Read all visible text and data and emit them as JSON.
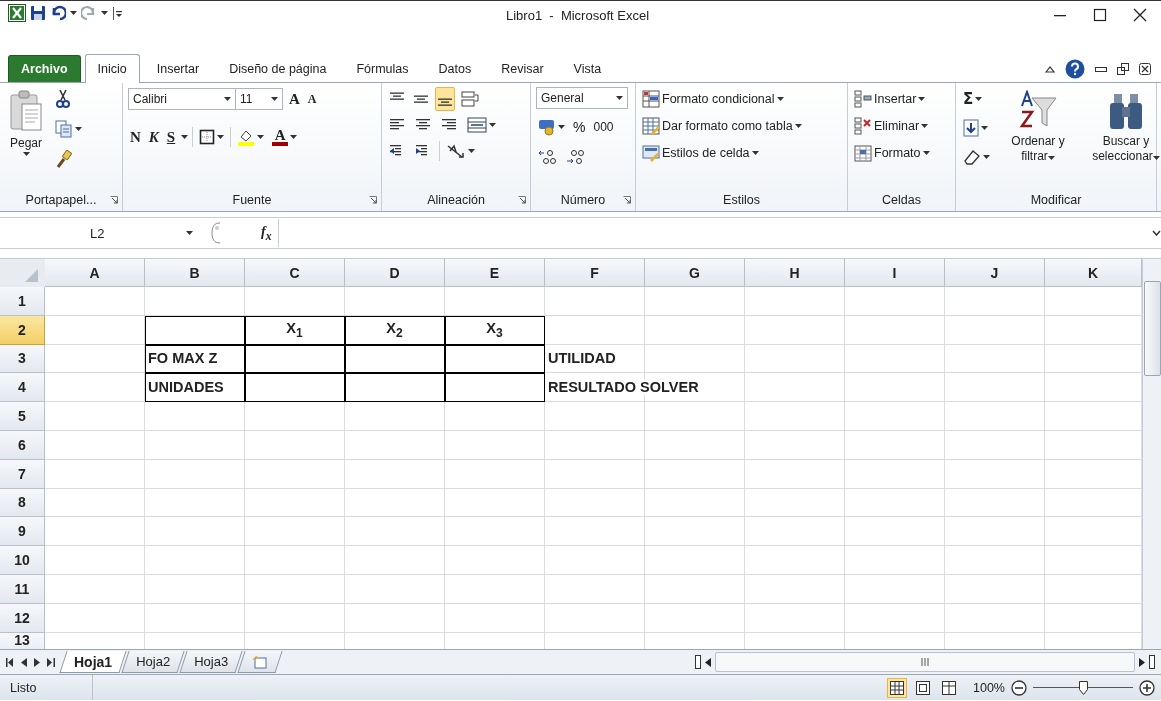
{
  "window": {
    "title": "Libro1  -  Microsoft Excel"
  },
  "ribbon_tabs": [
    {
      "label": "Archivo",
      "kind": "file",
      "selected": false
    },
    {
      "label": "Inicio",
      "kind": "tab",
      "selected": true
    },
    {
      "label": "Insertar",
      "kind": "tab",
      "selected": false
    },
    {
      "label": "Diseño de página",
      "kind": "tab",
      "selected": false
    },
    {
      "label": "Fórmulas",
      "kind": "tab",
      "selected": false
    },
    {
      "label": "Datos",
      "kind": "tab",
      "selected": false
    },
    {
      "label": "Revisar",
      "kind": "tab",
      "selected": false
    },
    {
      "label": "Vista",
      "kind": "tab",
      "selected": false
    }
  ],
  "clipboard": {
    "paste": "Pegar",
    "label": "Portapapel..."
  },
  "font": {
    "name": "Calibri",
    "size": "11",
    "grow": "A",
    "shrink": "A",
    "bold": "N",
    "italic": "K",
    "underline": "S",
    "font_color": "A",
    "label": "Fuente"
  },
  "alignment": {
    "vertical": [
      {
        "selected": false
      },
      {
        "selected": false
      },
      {
        "selected": true
      }
    ],
    "label": "Alineación"
  },
  "number": {
    "format": "General",
    "percent": "%",
    "thousands": "000",
    "label": "Número"
  },
  "styles": {
    "items": [
      "Formato condicional",
      "Dar formato como tabla",
      "Estilos de celda"
    ],
    "label": "Estilos"
  },
  "cells": {
    "items": [
      "Insertar",
      "Eliminar",
      "Formato"
    ],
    "label": "Celdas"
  },
  "editing": {
    "autosum": "Σ",
    "sort": "Ordenar y filtrar",
    "find": "Buscar y seleccionar",
    "label": "Modificar"
  },
  "formula_bar": {
    "name_box": "L2",
    "function_label": "f$_{x}$"
  },
  "sheet": {
    "columns": [
      "A",
      "B",
      "C",
      "D",
      "E",
      "F",
      "G",
      "H",
      "I",
      "J",
      "K"
    ],
    "rows": [
      {
        "header": "1",
        "selected": false,
        "cells": [
          null,
          null,
          null,
          null,
          null,
          null,
          null,
          null,
          null,
          null,
          null
        ]
      },
      {
        "header": "2",
        "selected": true,
        "cells": [
          null,
          {
            "border": true
          },
          {
            "text": "X$_{1}$",
            "bold": true,
            "centered": true,
            "border": true
          },
          {
            "text": "X$_{2}$",
            "bold": true,
            "centered": true,
            "border": true
          },
          {
            "text": "X$_{3}$",
            "bold": true,
            "centered": true,
            "border": true
          },
          null,
          null,
          null,
          null,
          null,
          null
        ]
      },
      {
        "header": "3",
        "selected": false,
        "cells": [
          null,
          {
            "text": "FO MAX Z",
            "bold": true,
            "centered": false,
            "border": true
          },
          {
            "border": true
          },
          {
            "border": true
          },
          {
            "border": true
          },
          {
            "text": "UTILIDAD",
            "bold": true,
            "centered": false,
            "border": false
          },
          null,
          null,
          null,
          null,
          null
        ]
      },
      {
        "header": "4",
        "selected": false,
        "cells": [
          null,
          {
            "text": "UNIDADES",
            "bold": true,
            "centered": false,
            "border": true
          },
          {
            "border": true
          },
          {
            "border": true
          },
          {
            "border": true
          },
          {
            "text": "RESULTADO SOLVER",
            "bold": true,
            "centered": false,
            "border": false
          },
          null,
          null,
          null,
          null,
          null
        ]
      },
      {
        "header": "5",
        "selected": false,
        "cells": [
          null,
          null,
          null,
          null,
          null,
          null,
          null,
          null,
          null,
          null,
          null
        ]
      },
      {
        "header": "6",
        "selected": false,
        "cells": [
          null,
          null,
          null,
          null,
          null,
          null,
          null,
          null,
          null,
          null,
          null
        ]
      },
      {
        "header": "7",
        "selected": false,
        "cells": [
          null,
          null,
          null,
          null,
          null,
          null,
          null,
          null,
          null,
          null,
          null
        ]
      },
      {
        "header": "8",
        "selected": false,
        "cells": [
          null,
          null,
          null,
          null,
          null,
          null,
          null,
          null,
          null,
          null,
          null
        ]
      },
      {
        "header": "9",
        "selected": false,
        "cells": [
          null,
          null,
          null,
          null,
          null,
          null,
          null,
          null,
          null,
          null,
          null
        ]
      },
      {
        "header": "10",
        "selected": false,
        "cells": [
          null,
          null,
          null,
          null,
          null,
          null,
          null,
          null,
          null,
          null,
          null
        ]
      },
      {
        "header": "11",
        "selected": false,
        "cells": [
          null,
          null,
          null,
          null,
          null,
          null,
          null,
          null,
          null,
          null,
          null
        ]
      },
      {
        "header": "12",
        "selected": false,
        "cells": [
          null,
          null,
          null,
          null,
          null,
          null,
          null,
          null,
          null,
          null,
          null
        ]
      },
      {
        "header": "13",
        "selected": false,
        "cells": [
          null,
          null,
          null,
          null,
          null,
          null,
          null,
          null,
          null,
          null,
          null
        ]
      }
    ]
  },
  "sheet_tabs": [
    {
      "label": "Hoja1",
      "selected": true
    },
    {
      "label": "Hoja2",
      "selected": false
    },
    {
      "label": "Hoja3",
      "selected": false
    }
  ],
  "status_bar": {
    "status": "Listo",
    "views": [
      {
        "selected": true
      },
      {
        "selected": false
      },
      {
        "selected": false
      }
    ],
    "zoom": "100%",
    "zoom_slider": {
      "level": 0.5
    }
  }
}
